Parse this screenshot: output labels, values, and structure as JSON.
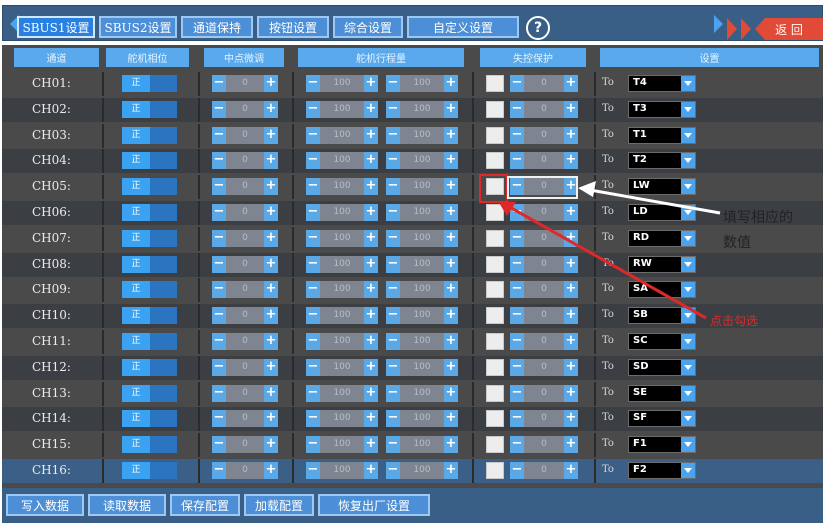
{
  "tabs": [
    "SBUS1设置",
    "SBUS2设置",
    "通道保持",
    "按钮设置",
    "综合设置",
    "自定义设置"
  ],
  "help_label": "?",
  "back_label": "返 回",
  "headers": {
    "channel": "通道",
    "reverse": "舵机相位",
    "center": "中点微调",
    "travel": "舵机行程量",
    "failsafe": "失控保护",
    "settings": "设置"
  },
  "reverse_label": "正",
  "center_value": "0",
  "travel_low": "100",
  "travel_high": "100",
  "failsafe_value": "0",
  "to_label": "To",
  "channels": [
    {
      "name": "CH01:",
      "source": "T4"
    },
    {
      "name": "CH02:",
      "source": "T3"
    },
    {
      "name": "CH03:",
      "source": "T1"
    },
    {
      "name": "CH04:",
      "source": "T2"
    },
    {
      "name": "CH05:",
      "source": "LW"
    },
    {
      "name": "CH06:",
      "source": "LD"
    },
    {
      "name": "CH07:",
      "source": "RD"
    },
    {
      "name": "CH08:",
      "source": "RW"
    },
    {
      "name": "CH09:",
      "source": "SA"
    },
    {
      "name": "CH10:",
      "source": "SB"
    },
    {
      "name": "CH11:",
      "source": "SC"
    },
    {
      "name": "CH12:",
      "source": "SD"
    },
    {
      "name": "CH13:",
      "source": "SE"
    },
    {
      "name": "CH14:",
      "source": "SF"
    },
    {
      "name": "CH15:",
      "source": "F1"
    },
    {
      "name": "CH16:",
      "source": "F2"
    }
  ],
  "bottom_buttons": [
    "写入数据",
    "读取数据",
    "保存配置",
    "加载配置",
    "恢复出厂设置"
  ],
  "annotations": {
    "fill_value_line1": "填写相应的",
    "fill_value_line2": "数值",
    "click_select": "点击勾选"
  },
  "colors": {
    "accent": "#4d8fd6",
    "highlight": "#e02828",
    "back": "#e04a36"
  }
}
